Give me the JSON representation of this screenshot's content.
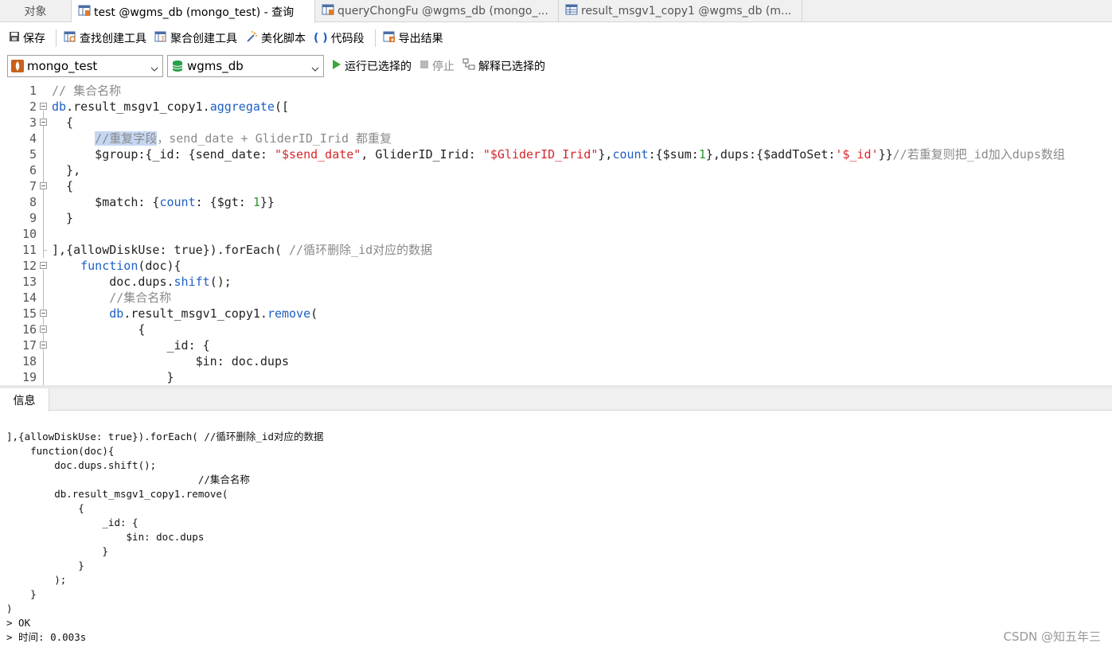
{
  "tabs": [
    {
      "label": "对象",
      "icon": "none"
    },
    {
      "label": "test @wgms_db (mongo_test) - 查询",
      "icon": "query-icon"
    },
    {
      "label": "queryChongFu @wgms_db (mongo_...",
      "icon": "query-icon"
    },
    {
      "label": "result_msgv1_copy1 @wgms_db (m...",
      "icon": "table-icon"
    }
  ],
  "toolbar": {
    "save": "保存",
    "find_builder": "查找创建工具",
    "aggregate_builder": "聚合创建工具",
    "beautify": "美化脚本",
    "snippet": "代码段",
    "export": "导出结果"
  },
  "selectors": {
    "connection": "mongo_test",
    "database": "wgms_db",
    "run": "运行已选择的",
    "stop": "停止",
    "explain": "解释已选择的"
  },
  "editor": {
    "line_numbers": [
      "1",
      "2",
      "3",
      "4",
      "5",
      "6",
      "7",
      "8",
      "9",
      "10",
      "11",
      "12",
      "13",
      "14",
      "15",
      "16",
      "17",
      "18",
      "19"
    ]
  },
  "info_tab": "信息",
  "output_lines": [
    "],{allowDiskUse: true}).forEach( //循环删除_id对应的数据",
    "    function(doc){",
    "        doc.dups.shift();",
    "                                //集合名称",
    "        db.result_msgv1_copy1.remove(",
    "            {",
    "                _id: {",
    "                    $in: doc.dups",
    "                }",
    "            }",
    "        );",
    "    }",
    ")",
    "> OK",
    "> 时间: 0.003s"
  ],
  "watermark": "CSDN @知五年三"
}
